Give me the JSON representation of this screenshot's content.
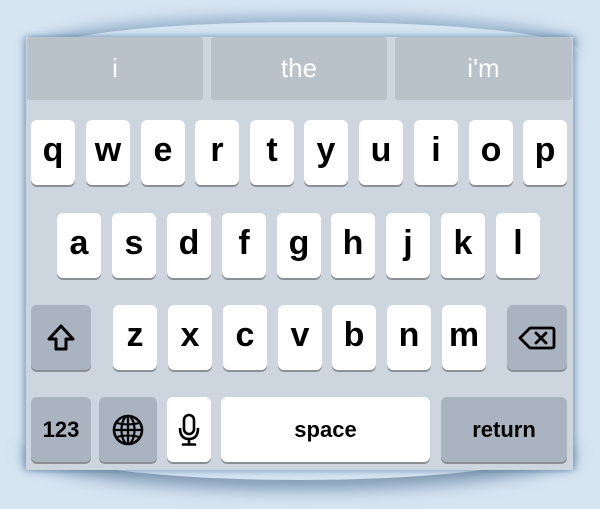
{
  "suggestions": [
    "i",
    "the",
    "i'm"
  ],
  "rows": {
    "row1": [
      "q",
      "w",
      "e",
      "r",
      "t",
      "y",
      "u",
      "i",
      "o",
      "p"
    ],
    "row2": [
      "a",
      "s",
      "d",
      "f",
      "g",
      "h",
      "j",
      "k",
      "l"
    ],
    "row3": [
      "z",
      "x",
      "c",
      "v",
      "b",
      "n",
      "m"
    ]
  },
  "keys": {
    "shift_icon": "shift-icon",
    "backspace_icon": "backspace-icon",
    "numbers_label": "123",
    "globe_icon": "globe-icon",
    "mic_icon": "microphone-icon",
    "space_label": "space",
    "return_label": "return"
  },
  "colors": {
    "keyboard_bg": "#cdd5df",
    "letter_key": "#ffffff",
    "function_key": "#aab4c0",
    "suggestion_bg": "#b9c1c9",
    "suggestion_text": "#ffffff"
  }
}
